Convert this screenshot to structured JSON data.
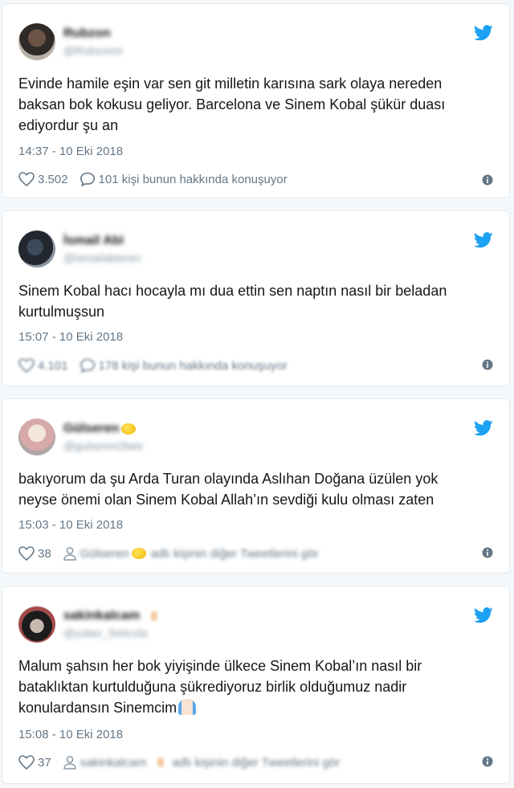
{
  "colors": {
    "twitter_blue": "#1da1f2",
    "text": "#14171a",
    "muted": "#657786",
    "border": "#e1e8ed",
    "background": "#f5f8fa"
  },
  "tweets": [
    {
      "display_name": "Rubzon",
      "handle": "@Rubzonm",
      "text": "Evinde hamile eşin var sen git milletin karısına sark olaya nereden\nbaksan bok kokusu geliyor. Barcelona ve Sinem Kobal şükür duası\nediyordur şu an",
      "timestamp": "14:37 - 10 Eki 2018",
      "likes": "3.502",
      "replies_label": "101 kişi bunun hakkında konuşuyor"
    },
    {
      "display_name": "İsmail Abi",
      "handle": "@ismailabieren",
      "text": "Sinem Kobal hacı hocayla mı dua ettin sen naptın nasıl bir beladan\nkurtulmuşsun",
      "timestamp": "15:07 - 10 Eki 2018",
      "likes": "4.101",
      "replies_label": "178 kişi bunun hakkında konuşuyor"
    },
    {
      "display_name": "Gülseren",
      "handle": "@gulseren2bee",
      "text": "bakıyorum da şu Arda Turan  olayında Aslıhan Doğana üzülen yok\nneyse önemi olan Sinem Kobal Allah’ın sevdiği kulu olması zaten",
      "timestamp": "15:03 - 10 Eki 2018",
      "likes": "38",
      "author_name_label": "Gülseren",
      "more_label": "adlı kişinin diğer Tweetlerini gör"
    },
    {
      "display_name": "sakinkalcam",
      "handle": "@yoker_5eticola",
      "text": "Malum şahsın her bok yiyişinde ülkece Sinem Kobal’ın nasıl bir\nbataklıktan kurtulduğuna şükrediyoruz birlik olduğumuz nadir\nkonulardansın Sinemcim",
      "timestamp": "15:08 - 10 Eki 2018",
      "likes": "37",
      "author_name_label": "sakinkalcam",
      "more_label": "adlı kişinin diğer Tweetlerini gör"
    }
  ],
  "icons": {
    "brand": "twitter-bird-icon",
    "like": "heart-icon",
    "reply": "speech-bubble-icon",
    "profile": "person-icon",
    "info": "info-icon"
  }
}
